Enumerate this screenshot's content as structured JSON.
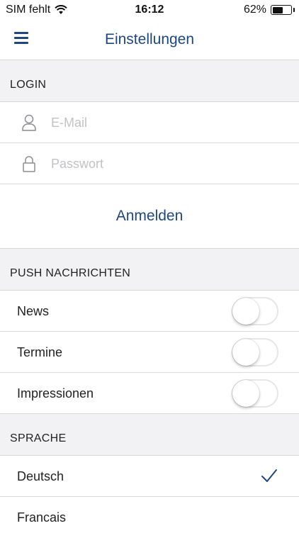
{
  "status_bar": {
    "carrier": "SIM fehlt",
    "time": "16:12",
    "battery_percent": "62%",
    "battery_level": 0.62
  },
  "nav": {
    "title": "Einstellungen",
    "menu_icon": "hamburger-menu-icon"
  },
  "accent_color": "#1e4680",
  "login": {
    "header": "LOGIN",
    "email_placeholder": "E-Mail",
    "email_icon": "user-icon",
    "password_placeholder": "Passwort",
    "password_icon": "lock-icon",
    "submit_label": "Anmelden"
  },
  "push": {
    "header": "PUSH NACHRICHTEN",
    "items": [
      {
        "label": "News",
        "enabled": false
      },
      {
        "label": "Termine",
        "enabled": false
      },
      {
        "label": "Impressionen",
        "enabled": false
      }
    ]
  },
  "language": {
    "header": "SPRACHE",
    "options": [
      {
        "label": "Deutsch",
        "selected": true
      },
      {
        "label": "Francais",
        "selected": false
      }
    ]
  }
}
